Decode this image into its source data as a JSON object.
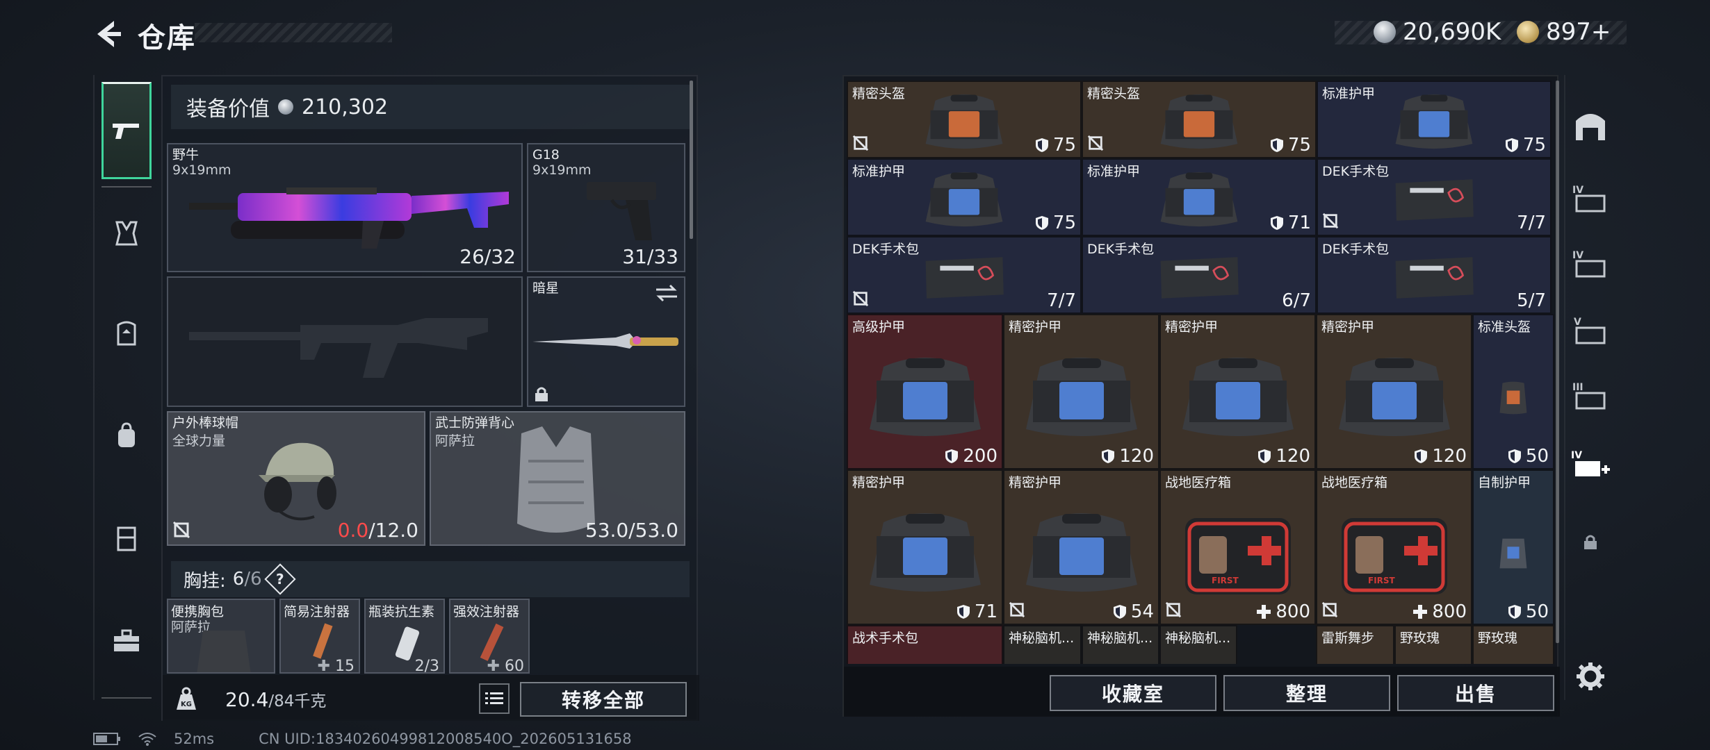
{
  "header": {
    "title": "仓库",
    "currency_silver": "20,690K",
    "currency_gold": "897+"
  },
  "left_tabs": [
    "weapon-tab",
    "chest-rig-tab",
    "armor-tab",
    "backpack-tab",
    "storage-tab",
    "toolbox-tab"
  ],
  "equipment": {
    "value_label": "装备价值",
    "value": "210,302",
    "primary_weapon": {
      "name": "野牛",
      "caliber": "9x19mm",
      "ammo": "26/32"
    },
    "secondary_weapon": {
      "name": "G18",
      "caliber": "9x19mm",
      "ammo": "31/33"
    },
    "melee": {
      "name": "暗星"
    },
    "helmet": {
      "name": "户外棒球帽",
      "sub": "全球力量",
      "durability_current": "0.0",
      "durability_max": "/12.0"
    },
    "armor": {
      "name": "武士防弹背心",
      "sub": "阿萨拉",
      "durability": "53.0/53.0"
    },
    "chest": {
      "label": "胸挂:",
      "count_current": "6",
      "count_sep": "/",
      "count_max": "6",
      "help": "?"
    },
    "chest_items": [
      {
        "name": "便携胸包",
        "sub": "阿萨拉",
        "count": ""
      },
      {
        "name": "简易注射器",
        "sub": "",
        "count": "15"
      },
      {
        "name": "瓶装抗生素",
        "sub": "",
        "count": "2/3"
      },
      {
        "name": "强效注射器",
        "sub": "",
        "count": "60"
      }
    ],
    "weight_current": "20.4",
    "weight_max": "/84千克",
    "transfer_all": "转移全部"
  },
  "storage": {
    "items": [
      {
        "name": "精密头盔",
        "value": "75",
        "kind": "shield",
        "bg": "brown",
        "art": "bag-orange"
      },
      {
        "name": "精密头盔",
        "value": "75",
        "kind": "shield",
        "bg": "brown",
        "art": "bag-orange"
      },
      {
        "name": "标准护甲",
        "value": "75",
        "kind": "shield",
        "bg": "blue",
        "art": "bag-blue"
      },
      {
        "name": "标准护甲",
        "value": "75",
        "kind": "shield",
        "bg": "blue",
        "art": "bag-blue"
      },
      {
        "name": "标准护甲",
        "value": "71",
        "kind": "shield",
        "bg": "blue",
        "art": "bag-blue"
      },
      {
        "name": "DEK手术包",
        "value": "7/7",
        "kind": "plain",
        "bg": "blue",
        "art": "surgery"
      },
      {
        "name": "DEK手术包",
        "value": "7/7",
        "kind": "plain",
        "bg": "blue",
        "art": "surgery"
      },
      {
        "name": "DEK手术包",
        "value": "6/7",
        "kind": "plain",
        "bg": "blue",
        "art": "surgery"
      },
      {
        "name": "DEK手术包",
        "value": "5/7",
        "kind": "plain",
        "bg": "blue",
        "art": "surgery"
      },
      {
        "name": "高级护甲",
        "value": "200",
        "kind": "shield",
        "bg": "red",
        "art": "bag-big"
      },
      {
        "name": "精密护甲",
        "value": "120",
        "kind": "shield",
        "bg": "brown",
        "art": "bag-big"
      },
      {
        "name": "精密护甲",
        "value": "120",
        "kind": "shield",
        "bg": "brown",
        "art": "bag-big"
      },
      {
        "name": "精密护甲",
        "value": "120",
        "kind": "shield",
        "bg": "brown",
        "art": "bag-big"
      },
      {
        "name": "标准头盔",
        "value": "50",
        "kind": "shield",
        "bg": "blue",
        "art": "helmet-tall"
      },
      {
        "name": "精密护甲",
        "value": "71",
        "kind": "shield",
        "bg": "brown",
        "art": "bag-big"
      },
      {
        "name": "精密护甲",
        "value": "54",
        "kind": "shield",
        "bg": "brown",
        "art": "bag-big"
      },
      {
        "name": "战地医疗箱",
        "value": "800",
        "kind": "plus",
        "bg": "brown",
        "art": "medkit"
      },
      {
        "name": "战地医疗箱",
        "value": "800",
        "kind": "plus",
        "bg": "brown",
        "art": "medkit"
      },
      {
        "name": "自制护甲",
        "value": "50",
        "kind": "shield",
        "bg": "steel",
        "art": "vest-tall"
      },
      {
        "name": "战术手术包",
        "value": "",
        "kind": "plain",
        "bg": "red",
        "art": "none"
      },
      {
        "name": "神秘脑机...",
        "value": "",
        "kind": "plain",
        "bg": "dark",
        "art": "none"
      },
      {
        "name": "神秘脑机...",
        "value": "",
        "kind": "plain",
        "bg": "dark",
        "art": "none"
      },
      {
        "name": "神秘脑机...",
        "value": "",
        "kind": "plain",
        "bg": "dark",
        "art": "none"
      },
      {
        "name": "雷斯舞步",
        "value": "",
        "kind": "plain",
        "bg": "brown",
        "art": "none"
      },
      {
        "name": "野玫瑰",
        "value": "",
        "kind": "plain",
        "bg": "brown",
        "art": "none"
      },
      {
        "name": "野玫瑰",
        "value": "",
        "kind": "plain",
        "bg": "brown",
        "art": "none"
      }
    ],
    "buttons": {
      "collection": "收藏室",
      "sort": "整理",
      "sell": "出售"
    }
  },
  "status": {
    "ping": "52ms",
    "uid": "CN UID:18340260499812008540O_202605131658"
  },
  "colors": {
    "accent_green": "#3fd59c",
    "durability_red": "#ff4b4b",
    "cell_brown": "#3c3229",
    "cell_blue": "#23283d",
    "cell_red": "#4a2227"
  }
}
